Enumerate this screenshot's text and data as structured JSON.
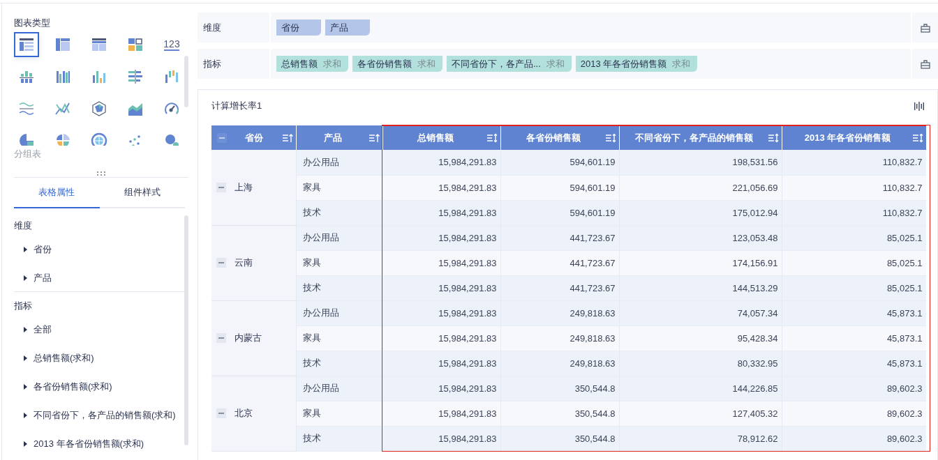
{
  "chart_types": {
    "title": "图表类型",
    "hover_label": "分组表",
    "items": [
      {
        "kind": "group-table",
        "selected": true
      },
      {
        "kind": "cross-table",
        "selected": false
      },
      {
        "kind": "detail-table",
        "selected": false
      },
      {
        "kind": "treemap",
        "selected": false
      },
      {
        "kind": "kpi",
        "selected": false,
        "glyph": "123"
      },
      {
        "kind": "stacked-column",
        "selected": false
      },
      {
        "kind": "grouped-column",
        "selected": false
      },
      {
        "kind": "column",
        "selected": false
      },
      {
        "kind": "bar",
        "selected": false
      },
      {
        "kind": "range-column",
        "selected": false
      },
      {
        "kind": "wave",
        "selected": false
      },
      {
        "kind": "line",
        "selected": false
      },
      {
        "kind": "radar",
        "selected": false
      },
      {
        "kind": "area",
        "selected": false
      },
      {
        "kind": "gauge",
        "selected": false
      },
      {
        "kind": "pie",
        "selected": false
      },
      {
        "kind": "rose",
        "selected": false
      },
      {
        "kind": "sunburst",
        "selected": false
      },
      {
        "kind": "scatter",
        "selected": false
      },
      {
        "kind": "bubble",
        "selected": false
      }
    ]
  },
  "property_tabs": [
    {
      "label": "表格属性",
      "selected": true
    },
    {
      "label": "组件样式",
      "selected": false
    }
  ],
  "field_sections": [
    {
      "title": "维度",
      "items": [
        {
          "label": "省份",
          "expanded": false
        },
        {
          "label": "产品",
          "expanded": false
        }
      ]
    },
    {
      "title": "指标",
      "items": [
        {
          "label": "全部",
          "expanded": false
        },
        {
          "label": "总销售额(求和)",
          "expanded": false
        },
        {
          "label": "各省份销售额(求和)",
          "expanded": false
        },
        {
          "label": "不同省份下，各产品的销售额(求和)",
          "expanded": false
        },
        {
          "label": "2013 年各省份销售额(求和)",
          "expanded": false
        }
      ]
    }
  ],
  "shelves": [
    {
      "label": "维度",
      "kind": "dimension",
      "chips": [
        {
          "name": "省份"
        },
        {
          "name": "产品"
        }
      ]
    },
    {
      "label": "指标",
      "kind": "measure",
      "chips": [
        {
          "name": "总销售额",
          "aggregation": "求和"
        },
        {
          "name": "各省份销售额",
          "aggregation": "求和"
        },
        {
          "name": "不同省份下，各产品...",
          "aggregation": "求和"
        },
        {
          "name": "2013 年各省份销售额",
          "aggregation": "求和"
        }
      ]
    }
  ],
  "widget": {
    "title": "计算增长率1",
    "table": {
      "columns": [
        {
          "label": "省份",
          "sorted_ascending": true,
          "collapse_button": true,
          "highlighted": false
        },
        {
          "label": "产品",
          "sorted_ascending": true,
          "collapse_button": false,
          "highlighted": false
        },
        {
          "label": "总销售额",
          "sorted_ascending": false,
          "collapse_button": false,
          "highlighted": true
        },
        {
          "label": "各省份销售额",
          "sorted_ascending": false,
          "collapse_button": false,
          "highlighted": true
        },
        {
          "label": "不同省份下，各产品的销售额",
          "sorted_ascending": false,
          "collapse_button": false,
          "highlighted": true
        },
        {
          "label": "2013 年各省份销售额",
          "sorted_ascending": false,
          "collapse_button": false,
          "highlighted": true
        }
      ],
      "groups": [
        {
          "province": "上海",
          "expanded": true,
          "rows": [
            {
              "product": "办公用品",
              "values": [
                "15,984,291.83",
                "594,601.19",
                "198,531.56",
                "110,832.7"
              ]
            },
            {
              "product": "家具",
              "values": [
                "15,984,291.83",
                "594,601.19",
                "221,056.69",
                "110,832.7"
              ]
            },
            {
              "product": "技术",
              "values": [
                "15,984,291.83",
                "594,601.19",
                "175,012.94",
                "110,832.7"
              ]
            }
          ]
        },
        {
          "province": "云南",
          "expanded": true,
          "rows": [
            {
              "product": "办公用品",
              "values": [
                "15,984,291.83",
                "441,723.67",
                "123,053.48",
                "85,025.1"
              ]
            },
            {
              "product": "家具",
              "values": [
                "15,984,291.83",
                "441,723.67",
                "174,156.91",
                "85,025.1"
              ]
            },
            {
              "product": "技术",
              "values": [
                "15,984,291.83",
                "441,723.67",
                "144,513.29",
                "85,025.1"
              ]
            }
          ]
        },
        {
          "province": "内蒙古",
          "expanded": true,
          "rows": [
            {
              "product": "办公用品",
              "values": [
                "15,984,291.83",
                "249,818.63",
                "74,057.34",
                "45,873.1"
              ]
            },
            {
              "product": "家具",
              "values": [
                "15,984,291.83",
                "249,818.63",
                "95,428.34",
                "45,873.1"
              ]
            },
            {
              "product": "技术",
              "values": [
                "15,984,291.83",
                "249,818.63",
                "80,332.95",
                "45,873.1"
              ]
            }
          ]
        },
        {
          "province": "北京",
          "expanded": true,
          "rows": [
            {
              "product": "办公用品",
              "values": [
                "15,984,291.83",
                "350,544.8",
                "144,226.85",
                "89,602.3"
              ]
            },
            {
              "product": "家具",
              "values": [
                "15,984,291.83",
                "350,544.8",
                "127,405.32",
                "89,602.3"
              ]
            },
            {
              "product": "技术",
              "values": [
                "15,984,291.83",
                "350,544.8",
                "78,912.62",
                "89,602.3"
              ]
            }
          ]
        }
      ]
    }
  }
}
